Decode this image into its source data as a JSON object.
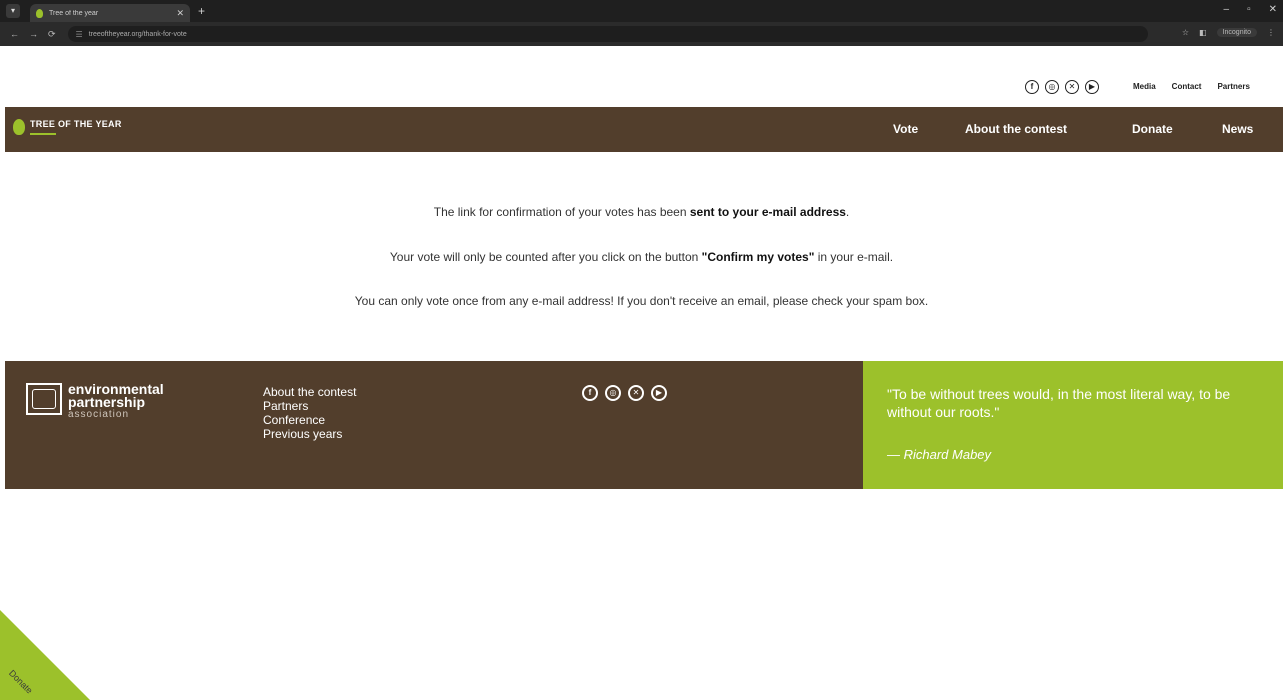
{
  "browser": {
    "tab_title": "Tree of the year",
    "url": "treeoftheyear.org/thank-for-vote",
    "incognito_label": "Incognito"
  },
  "util": {
    "social": [
      "facebook-icon",
      "instagram-icon",
      "x-icon",
      "youtube-icon"
    ],
    "links": [
      "Media",
      "Contact",
      "Partners"
    ]
  },
  "nav": {
    "logo_text": "TREE OF THE YEAR",
    "items": [
      "Vote",
      "About the contest",
      "Donate",
      "News"
    ]
  },
  "content": {
    "line1_pre": "The link for confirmation of your votes has been ",
    "line1_bold": "sent to your e-mail address",
    "line1_post": ".",
    "line2_pre": "Your vote will only be counted after you click on the button ",
    "line2_bold": "\"Confirm my votes\"",
    "line2_post": " in your e-mail.",
    "line3": "You can only vote once from any e-mail address! If you don't receive an email, please check your spam box."
  },
  "footer": {
    "org_line1": "environmental",
    "org_line2": "partnership",
    "org_line3": "association",
    "links": [
      "About the contest",
      "Partners",
      "Conference",
      "Previous years"
    ],
    "social": [
      "facebook-icon",
      "instagram-icon",
      "x-icon",
      "youtube-icon"
    ],
    "quote": "\"To be without trees would, in the most literal way, to be without our roots.\"",
    "quote_author": "— Richard Mabey"
  },
  "donate_corner_label": "Donate",
  "colors": {
    "brown": "#523e2c",
    "green": "#9cc12b"
  }
}
